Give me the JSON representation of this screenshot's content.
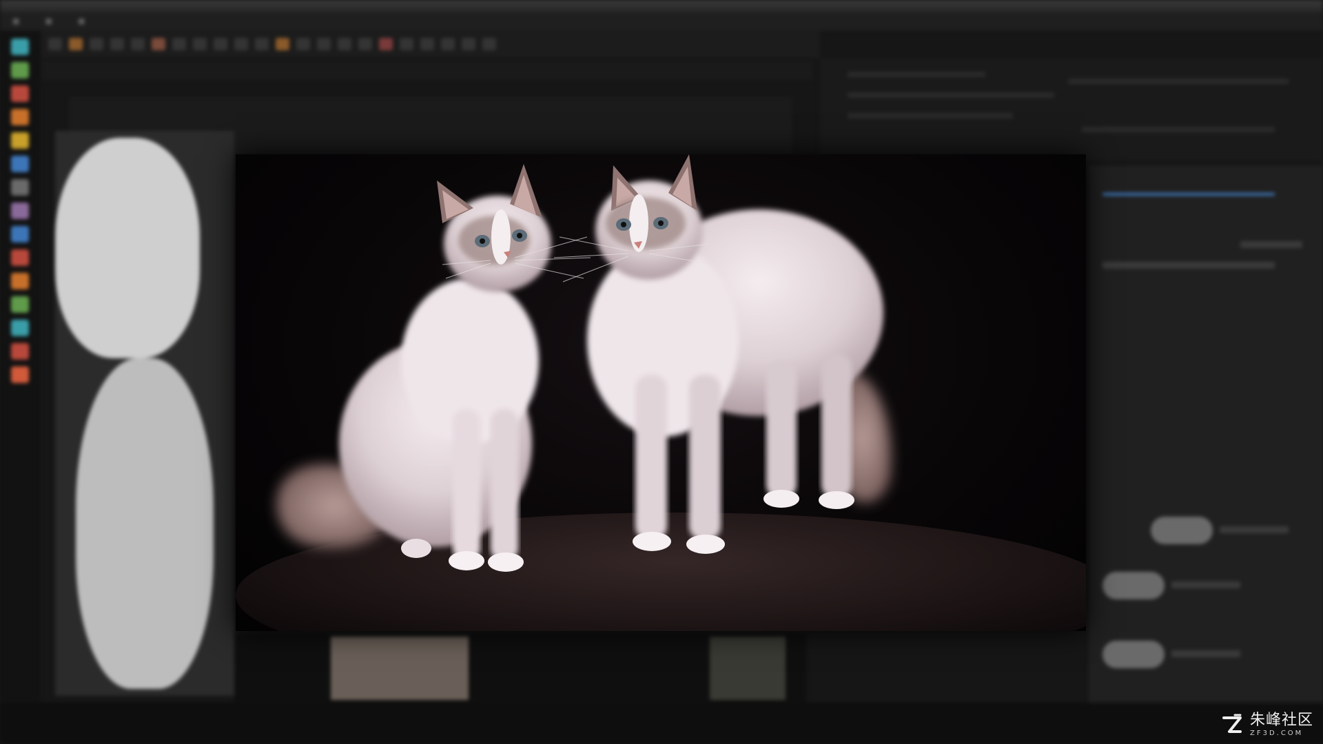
{
  "colors": {
    "background": "#161616",
    "accent_orange": "#c8702a",
    "accent_green": "#5f9b4a",
    "accent_blue": "#3d76b8",
    "accent_red": "#b8483b",
    "accent_teal": "#3a9ea8",
    "cat_fur": "#e8dcdc",
    "cat_point": "#9b7f7c"
  },
  "viewer": {
    "subject": "two-ragdoll-cats-render"
  },
  "watermark": {
    "brand_cn": "朱峰社区",
    "site": "ZF3D.COM",
    "icon": "zf-logo-icon"
  }
}
